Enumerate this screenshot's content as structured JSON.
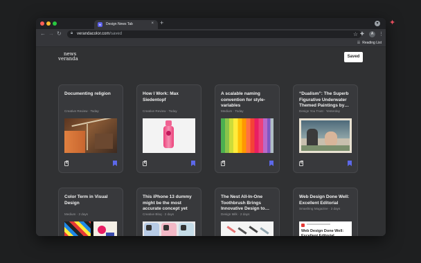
{
  "browser": {
    "tab_title": "Design News Tab",
    "tab_favicon": "N",
    "tab_close": "×",
    "new_tab": "+",
    "url_domain": "verandacolor.com",
    "url_path": "/saved",
    "reading_list": "Reading List",
    "avatar_initial": "A",
    "traffic_colors": [
      "#ff5f57",
      "#febc2e",
      "#28c840"
    ]
  },
  "page": {
    "logo_line1": "news",
    "logo_line2": "veranda",
    "saved_button": "Saved",
    "accent": "#5c68e8",
    "cards": [
      {
        "title": "Documenting religion",
        "source": "Creative Review",
        "date": "Today",
        "thumb": "loom-photo"
      },
      {
        "title": "How I Work: Max Siedentopf",
        "source": "Creative Review",
        "date": "Today",
        "thumb": "pink-bottle"
      },
      {
        "title": "A scalable naming convention for style-variables",
        "source": "Medium",
        "date": "Today",
        "thumb": "color-swatches"
      },
      {
        "title": "“Dualism”: The Superb Figurative Underwater Themed Paintings by…",
        "source": "Design You Trust",
        "date": "Yesterday",
        "thumb": "painting"
      },
      {
        "title": "Color Term in Visual Design",
        "source": "Medium",
        "date": "2 days",
        "thumb": "abstract-shapes"
      },
      {
        "title": "This iPhone 13 dummy might be the most accurate concept yet",
        "source": "Creative Bloq",
        "date": "2 days",
        "thumb": "iphones"
      },
      {
        "title": "The Nest All-In-One Toothbrush Brings Innovative Design to…",
        "source": "Design Milk",
        "date": "2 days",
        "thumb": "toothbrush"
      },
      {
        "title": "Web Design Done Well: Excellent Editorial",
        "source": "Smashing Magazine",
        "date": "2 days",
        "thumb": "editorial",
        "thumb_text": "Web Design Done Well: Excellent Editorial"
      }
    ]
  }
}
